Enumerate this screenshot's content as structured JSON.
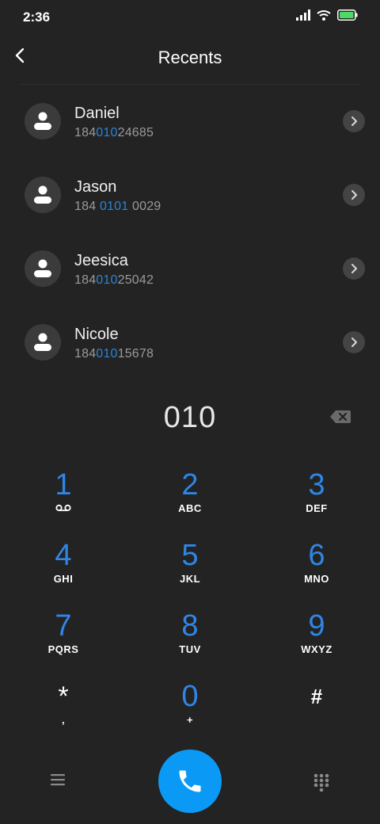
{
  "status_bar": {
    "time": "2:36"
  },
  "header": {
    "title": "Recents"
  },
  "contacts": [
    {
      "name": "Daniel",
      "number_pre": "184",
      "number_match": "010",
      "number_post": "24685"
    },
    {
      "name": "Jason",
      "number_pre": "184 ",
      "number_match": "0101",
      "number_post": " 0029"
    },
    {
      "name": "Jeesica",
      "number_pre": "184",
      "number_match": "010",
      "number_post": "25042"
    },
    {
      "name": "Nicole",
      "number_pre": "184",
      "number_match": "010",
      "number_post": "15678"
    }
  ],
  "dialer": {
    "value": "010"
  },
  "keypad": [
    {
      "digit": "1",
      "letters": ""
    },
    {
      "digit": "2",
      "letters": "ABC"
    },
    {
      "digit": "3",
      "letters": "DEF"
    },
    {
      "digit": "4",
      "letters": "GHI"
    },
    {
      "digit": "5",
      "letters": "JKL"
    },
    {
      "digit": "6",
      "letters": "MNO"
    },
    {
      "digit": "7",
      "letters": "PQRS"
    },
    {
      "digit": "8",
      "letters": "TUV"
    },
    {
      "digit": "9",
      "letters": "WXYZ"
    },
    {
      "digit": "*",
      "letters": ","
    },
    {
      "digit": "0",
      "letters": "+"
    },
    {
      "digit": "#",
      "letters": ""
    }
  ],
  "icons": {
    "back": "chevron-left-icon",
    "contact": "person-icon",
    "detail": "chevron-right-icon",
    "backspace": "backspace-icon",
    "voicemail": "voicemail-icon",
    "menu": "menu-icon",
    "call": "phone-icon",
    "dialpad": "dialpad-icon"
  },
  "colors": {
    "accent": "#2f86e6",
    "highlight": "#2a84d6",
    "call_button": "#0a9af5",
    "background": "#232323",
    "battery": "#4cd964"
  }
}
